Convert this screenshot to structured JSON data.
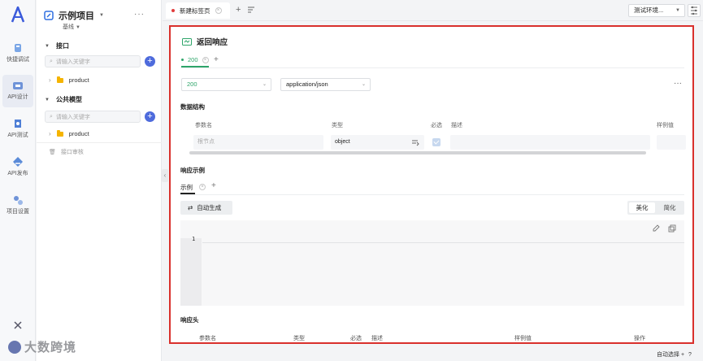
{
  "rail": {
    "items": [
      {
        "label": "快捷调试"
      },
      {
        "label": "API设计"
      },
      {
        "label": "API测试"
      },
      {
        "label": "API发布"
      },
      {
        "label": "项目设置"
      }
    ]
  },
  "sidebar": {
    "project_name": "示例项目",
    "branch": "基线",
    "api_section": "接口",
    "api_search_placeholder": "请输入关键字",
    "api_folder": "product",
    "model_section": "公共模型",
    "model_search_placeholder": "请输入关键字",
    "model_folder": "product",
    "recycle_bin": "接口审核"
  },
  "tabs": {
    "active_tab": "新建标签页",
    "env_select": "测试环境..."
  },
  "main": {
    "title": "返回响应",
    "status_tab": "200",
    "status_code": "200",
    "content_type": "application/json",
    "structure_title": "数据结构",
    "columns": {
      "param": "参数名",
      "type": "类型",
      "required": "必选",
      "desc": "描述",
      "example": "样例值"
    },
    "root_placeholder": "根节点",
    "root_type": "object",
    "example_section": "响应示例",
    "example_tab": "示例",
    "auto_gen": "自动生成",
    "beautify": "美化",
    "simplify": "简化",
    "line_number": "1",
    "headers_title": "响应头",
    "header_cols": {
      "param": "参数名",
      "type": "类型",
      "required": "必选",
      "desc": "描述",
      "example": "样例值",
      "op": "操作"
    }
  },
  "footer": {
    "auto_select": "自动选择 +",
    "help": "?"
  },
  "watermark": "大数跨境"
}
